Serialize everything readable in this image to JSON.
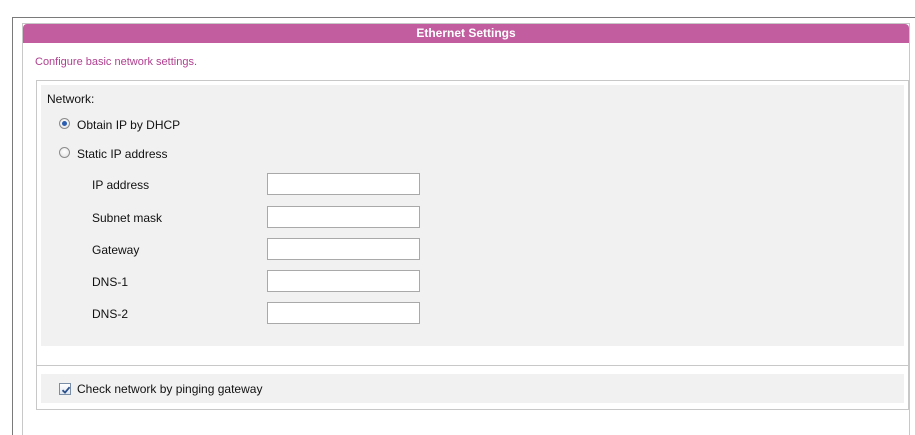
{
  "panel": {
    "title": "Ethernet Settings",
    "description": "Configure basic network settings."
  },
  "network": {
    "section_label": "Network:",
    "options": {
      "dhcp": {
        "label": "Obtain IP by DHCP",
        "checked": true
      },
      "static": {
        "label": "Static IP address",
        "checked": false
      }
    },
    "fields": {
      "ip_address": {
        "label": "IP address",
        "value": ""
      },
      "subnet_mask": {
        "label": "Subnet mask",
        "value": ""
      },
      "gateway": {
        "label": "Gateway",
        "value": ""
      },
      "dns1": {
        "label": "DNS-1",
        "value": ""
      },
      "dns2": {
        "label": "DNS-2",
        "value": ""
      }
    }
  },
  "ping": {
    "label": "Check network by pinging gateway",
    "checked": true
  },
  "colors": {
    "header_bg": "#c25e9f",
    "description_text": "#b04090",
    "section_bg": "#f1f1f1",
    "border": "#c8c8c8",
    "radio_dot": "#2a5db0"
  },
  "icons": {
    "radio": "radio-button",
    "checkbox": "checkmark-icon"
  }
}
